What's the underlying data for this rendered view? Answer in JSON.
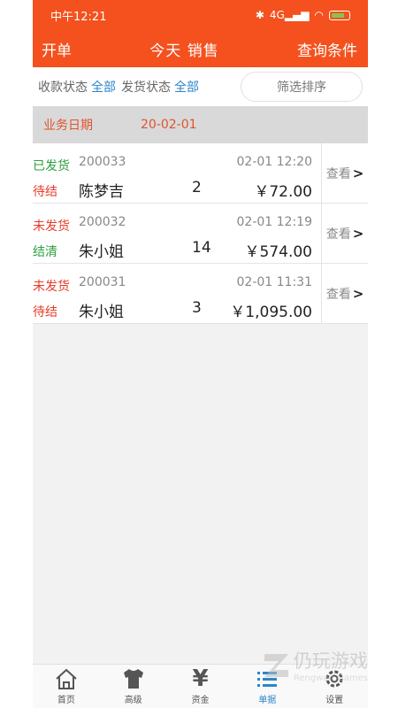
{
  "status_bar": {
    "time": "中午12:21",
    "signal": "4G"
  },
  "header": {
    "left": "开单",
    "title": "今天 销售",
    "right": "查询条件"
  },
  "filters": {
    "payment_label": "收款状态",
    "payment_value": "全部",
    "shipping_label": "发货状态",
    "shipping_value": "全部",
    "sort_button": "筛选排序"
  },
  "date_row": {
    "label": "业务日期",
    "value": "20-02-01"
  },
  "orders": [
    {
      "ship_status": "已发货",
      "pay_status": "待结",
      "order_no": "200033",
      "customer": "陈梦吉",
      "qty": "2",
      "time": "02-01 12:20",
      "amount": "￥72.00",
      "view": "查看"
    },
    {
      "ship_status": "未发货",
      "pay_status": "结清",
      "order_no": "200032",
      "customer": "朱小姐",
      "qty": "14",
      "time": "02-01 12:19",
      "amount": "￥574.00",
      "view": "查看"
    },
    {
      "ship_status": "未发货",
      "pay_status": "待结",
      "order_no": "200031",
      "customer": "朱小姐",
      "qty": "3",
      "time": "02-01 11:31",
      "amount": "￥1,095.00",
      "view": "查看"
    }
  ],
  "tabs": [
    {
      "label": "首页",
      "icon": "home-icon"
    },
    {
      "label": "高级",
      "icon": "shirt-icon"
    },
    {
      "label": "资金",
      "icon": "yen-icon"
    },
    {
      "label": "单据",
      "icon": "list-icon",
      "active": true
    },
    {
      "label": "设置",
      "icon": "gear-icon"
    }
  ],
  "watermark": {
    "main": "仍玩游戏",
    "sub": "Rengwan Games"
  },
  "colors": {
    "brand": "#f4511e",
    "link": "#2b86c9",
    "green": "#2c9f3d",
    "red": "#e83b2a"
  }
}
